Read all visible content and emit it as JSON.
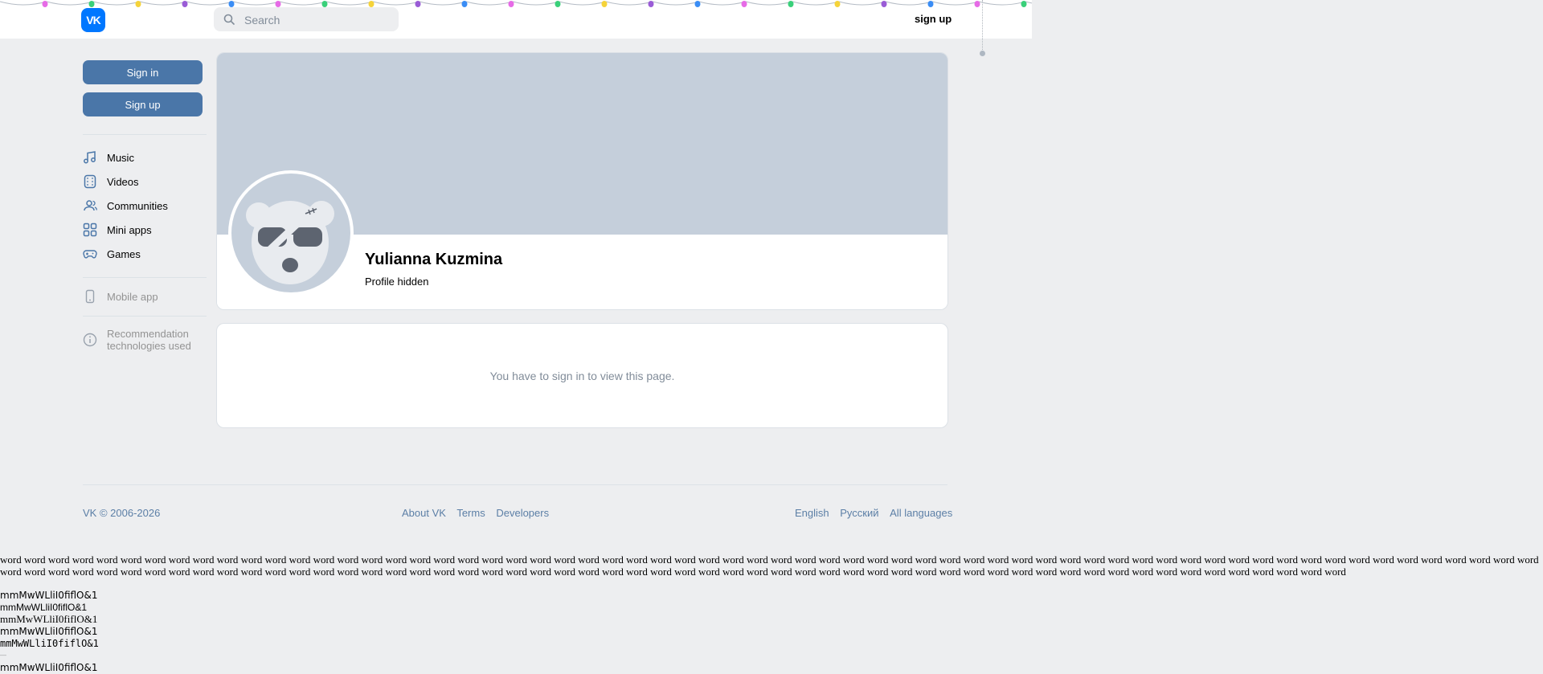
{
  "header": {
    "logo": "VK",
    "search_placeholder": "Search",
    "signup_link": "sign up"
  },
  "sidebar": {
    "signin_button": "Sign in",
    "signup_button": "Sign up",
    "items": [
      {
        "label": "Music",
        "icon": "music-note-icon"
      },
      {
        "label": "Videos",
        "icon": "video-icon"
      },
      {
        "label": "Communities",
        "icon": "users-icon"
      },
      {
        "label": "Mini apps",
        "icon": "grid-icon"
      },
      {
        "label": "Games",
        "icon": "gamepad-icon"
      }
    ],
    "mobile_app": "Mobile app",
    "recommendation_line1": "Recommendation",
    "recommendation_line2": "technologies used"
  },
  "profile": {
    "name": "Yulianna Kuzmina",
    "status": "Profile hidden"
  },
  "locked_message": "You have to sign in to view this page.",
  "footer": {
    "copyright": "VK © 2006-2026",
    "links": [
      "About VK",
      "Terms",
      "Developers"
    ],
    "languages": [
      "English",
      "Русский",
      "All languages"
    ]
  },
  "test_text": {
    "word": "word",
    "glyph_line": "mmMwWLliI0fiflO&1",
    "glyph_line_alt": "mmMwWLliI0fiflO&1",
    "dash": "—"
  },
  "colors": {
    "accent": "#4a76a8",
    "vk_blue": "#0077ff",
    "cover": "#c5cfdb",
    "background": "#edeef0",
    "link": "#5c7fa6"
  }
}
